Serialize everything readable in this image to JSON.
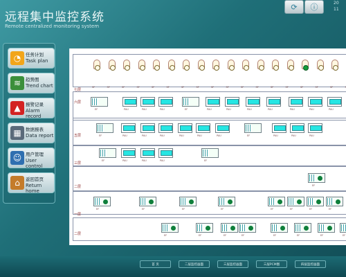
{
  "header": {
    "title_cn": "远程集中监控系统",
    "title_en": "Remote centralized monitoring system",
    "clock_line1": "20",
    "clock_line2": "11"
  },
  "top_icons": [
    {
      "icon": "refresh-icon"
    },
    {
      "icon": "info-icon"
    }
  ],
  "sidebar": {
    "items": [
      {
        "cn": "任务计划",
        "en": "Task plan",
        "icon": "clock-icon",
        "color": "#f2a51a"
      },
      {
        "cn": "趋势图",
        "en": "Trend chart",
        "icon": "chart-icon",
        "color": "#3b8f3b"
      },
      {
        "cn": "报警记录",
        "en": "Alarm record",
        "icon": "alarm-light-icon",
        "color": "#d32222"
      },
      {
        "cn": "数据报表",
        "en": "Data report",
        "icon": "printer-icon",
        "color": "#5a6a7a"
      },
      {
        "cn": "用户管理",
        "en": "User control",
        "icon": "users-icon",
        "color": "#2f6fb0"
      },
      {
        "cn": "返回首页",
        "en": "Return home",
        "icon": "home-icon",
        "color": "#c47b2a"
      }
    ]
  },
  "rows": [
    {
      "label": "七层"
    },
    {
      "label": "六层"
    },
    {
      "label": "五层"
    },
    {
      "label": "三层"
    },
    {
      "label": "二层"
    },
    {
      "label": "一层"
    },
    {
      "label": "二层"
    }
  ],
  "device_labels": {
    "fan": "SF",
    "ac": "PAU",
    "cab": "EF"
  },
  "bottom": {
    "buttons": [
      "首 页",
      "二层监控画面",
      "三层监控画面",
      "三层PCM图",
      "四层监控画面"
    ]
  }
}
